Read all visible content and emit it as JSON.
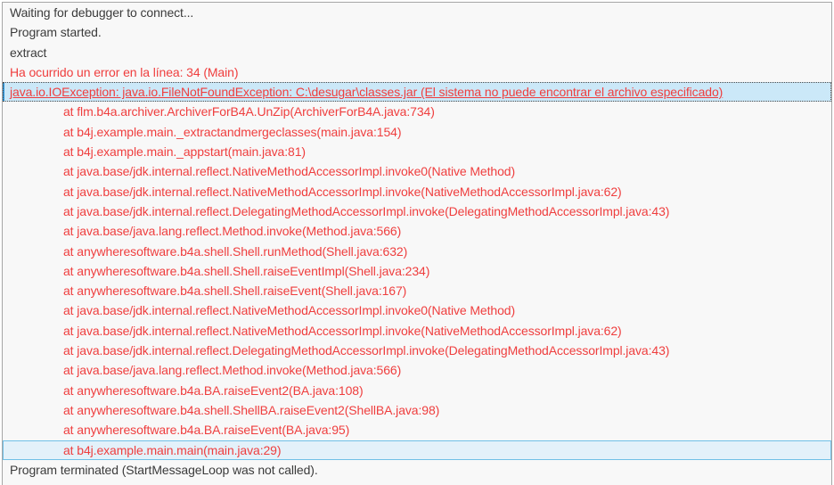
{
  "panel": {
    "name": "debugger-log-output",
    "background": "#f8f8f8",
    "border_color": "#a6a6a6"
  },
  "colors": {
    "info_text": "#3b3b3b",
    "error_text": "#ef3e3e",
    "selected_row_bg": "#cbe8f8",
    "selected_row_accent": "#2f97dd",
    "hover_row_bg": "#e3f1fa",
    "hover_row_border": "#70c0e7"
  },
  "log_lines": [
    {
      "text": "Waiting for debugger to connect...",
      "type": "info",
      "indent": 0,
      "state": "none"
    },
    {
      "text": "Program started.",
      "type": "info",
      "indent": 0,
      "state": "none"
    },
    {
      "text": "extract",
      "type": "info",
      "indent": 0,
      "state": "none"
    },
    {
      "text": "Ha ocurrido un error en la línea: 34 (Main)",
      "type": "error",
      "indent": 0,
      "state": "none"
    },
    {
      "text": "java.io.IOException: java.io.FileNotFoundException: C:\\desugar\\classes.jar (El sistema no puede encontrar el archivo especificado)",
      "type": "error",
      "indent": 0,
      "state": "selected"
    },
    {
      "text": "at flm.b4a.archiver.ArchiverForB4A.UnZip(ArchiverForB4A.java:734)",
      "type": "error",
      "indent": 1,
      "state": "none"
    },
    {
      "text": "at b4j.example.main._extractandmergeclasses(main.java:154)",
      "type": "error",
      "indent": 1,
      "state": "none"
    },
    {
      "text": "at b4j.example.main._appstart(main.java:81)",
      "type": "error",
      "indent": 1,
      "state": "none"
    },
    {
      "text": "at java.base/jdk.internal.reflect.NativeMethodAccessorImpl.invoke0(Native Method)",
      "type": "error",
      "indent": 1,
      "state": "none"
    },
    {
      "text": "at java.base/jdk.internal.reflect.NativeMethodAccessorImpl.invoke(NativeMethodAccessorImpl.java:62)",
      "type": "error",
      "indent": 1,
      "state": "none"
    },
    {
      "text": "at java.base/jdk.internal.reflect.DelegatingMethodAccessorImpl.invoke(DelegatingMethodAccessorImpl.java:43)",
      "type": "error",
      "indent": 1,
      "state": "none"
    },
    {
      "text": "at java.base/java.lang.reflect.Method.invoke(Method.java:566)",
      "type": "error",
      "indent": 1,
      "state": "none"
    },
    {
      "text": "at anywheresoftware.b4a.shell.Shell.runMethod(Shell.java:632)",
      "type": "error",
      "indent": 1,
      "state": "none"
    },
    {
      "text": "at anywheresoftware.b4a.shell.Shell.raiseEventImpl(Shell.java:234)",
      "type": "error",
      "indent": 1,
      "state": "none"
    },
    {
      "text": "at anywheresoftware.b4a.shell.Shell.raiseEvent(Shell.java:167)",
      "type": "error",
      "indent": 1,
      "state": "none"
    },
    {
      "text": "at java.base/jdk.internal.reflect.NativeMethodAccessorImpl.invoke0(Native Method)",
      "type": "error",
      "indent": 1,
      "state": "none"
    },
    {
      "text": "at java.base/jdk.internal.reflect.NativeMethodAccessorImpl.invoke(NativeMethodAccessorImpl.java:62)",
      "type": "error",
      "indent": 1,
      "state": "none"
    },
    {
      "text": "at java.base/jdk.internal.reflect.DelegatingMethodAccessorImpl.invoke(DelegatingMethodAccessorImpl.java:43)",
      "type": "error",
      "indent": 1,
      "state": "none"
    },
    {
      "text": "at java.base/java.lang.reflect.Method.invoke(Method.java:566)",
      "type": "error",
      "indent": 1,
      "state": "none"
    },
    {
      "text": "at anywheresoftware.b4a.BA.raiseEvent2(BA.java:108)",
      "type": "error",
      "indent": 1,
      "state": "none"
    },
    {
      "text": "at anywheresoftware.b4a.shell.ShellBA.raiseEvent2(ShellBA.java:98)",
      "type": "error",
      "indent": 1,
      "state": "none"
    },
    {
      "text": "at anywheresoftware.b4a.BA.raiseEvent(BA.java:95)",
      "type": "error",
      "indent": 1,
      "state": "none"
    },
    {
      "text": "at b4j.example.main.main(main.java:29)",
      "type": "error",
      "indent": 1,
      "state": "hover"
    },
    {
      "text": "Program terminated (StartMessageLoop was not called).",
      "type": "info",
      "indent": 0,
      "state": "none"
    }
  ]
}
